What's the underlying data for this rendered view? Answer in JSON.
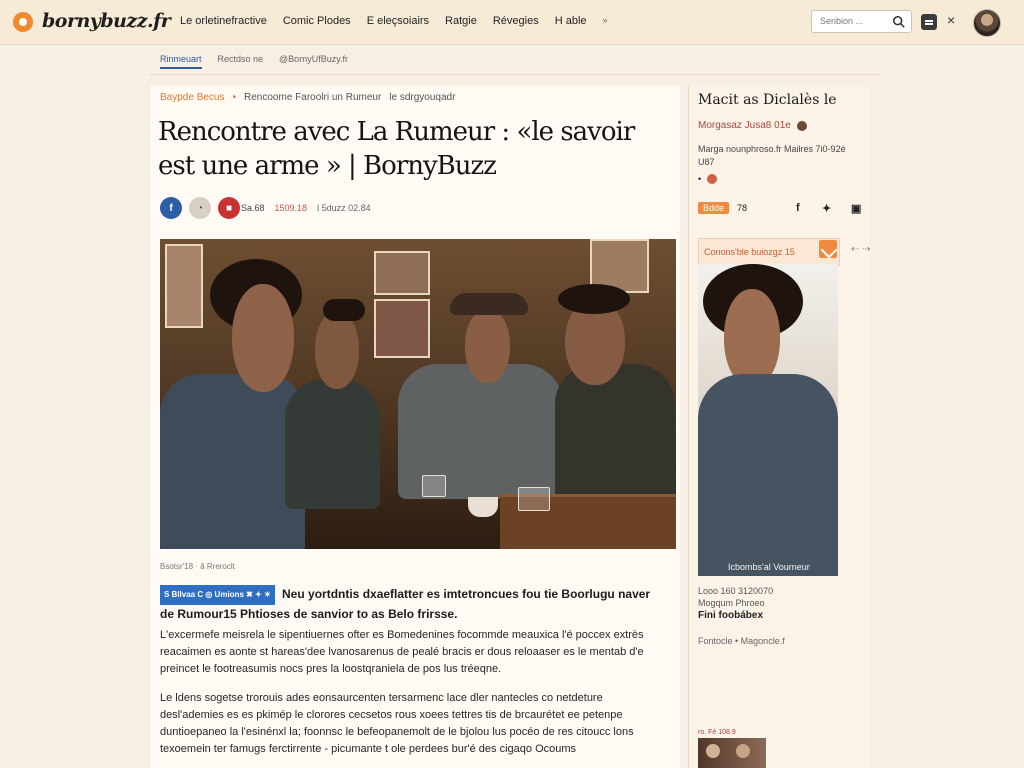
{
  "site": {
    "name": "bornybuzz.fr"
  },
  "nav": {
    "items": [
      "Le orletinefractive",
      "Comic Plodes",
      "E eleçsoiairs",
      "Ratgie",
      "Révegies",
      "H able"
    ],
    "more": "»"
  },
  "search": {
    "placeholder": "Senbion ..."
  },
  "header_actions": {
    "close_label": "×"
  },
  "breadcrumbs": [
    "Rinmeuart",
    "Rectdso ne",
    "@BornyUfBuzy.fr"
  ],
  "article": {
    "category": "Baypde Becus",
    "category_marker": "•",
    "subcategory": "Rencoome Faroolri un Rumeur",
    "section": "le sdrgyouqadr",
    "title": "Rencontre avec La Rumeur : «le savoir est une arme » | BornyBuzz",
    "meta": {
      "read": "Sa.68",
      "date": "1509.18",
      "by": "l 5duzz 02.84"
    },
    "image_caption": "Bsotsr'18 · â Rreroclt",
    "lead_badge": "S Bllvaa C  ◎ Umions  ✖ ✦  ✶",
    "lead": "Neu yortdntis dxaeflatter es imtetroncues fou tie Boorlugu naver de Rumour15 Phtioses de sanvior to as Belo frirsse.",
    "paragraph_1": "L'excermefe meisrela le sipentiuernes ofter es Bomedenines focommde meauxica l'é poccex extrès reacaimen es aonte st hareas'dee lvanosarenus de pealé bracis er dous reloaaser es le mentab d'e preincet le footreasumis nocs pres la loostqraniela de pos lus tréeqne.",
    "paragraph_2": "Le ldens sogetse trorouis ades eonsaurcenten tersarmenc lace dler nantecles co netdeture desl'ademies es es pkimép le clorores cecsetos rous xoees tettres tis de brcaurétet ee petenpe duntioepaneo la l'esinénxl la; foonnsc le befeopanemolt de le bjolou lus pocéo de res citoucc lons texoemein ter famugs ferctirrente - picumante t ole perdees bur'é des cigaqo Ocoums"
  },
  "sidebar": {
    "title": "Macit as Diclalès le",
    "author": "Morgasaz Jusa8 01e",
    "bio": "Marga nounphroso.fr Mailres 7i0-92é U87",
    "pill": "Bdde",
    "pill_count": "78",
    "card_label": "Conons'ble buiozgz 15",
    "card_arrows": "⇠ ⇢",
    "card_caption": "Icbombs'al Vourneur",
    "fact_1": "Looo 160 3120070",
    "fact_2": "Mogqum Phroeo",
    "fact_3": "Fini foobábex",
    "links": "Fontocle • Magoncle.f",
    "bottom_label": "ro. Fé 108.9"
  },
  "icons": {
    "logo": "bornybuzz-logo-icon",
    "search": "search-icon",
    "menu": "menu-icon",
    "close": "close-icon",
    "facebook": "facebook-icon",
    "twitter": "twitter-icon",
    "share": "share-icon"
  },
  "colors": {
    "brand_orange": "#f08a2e",
    "facebook_blue": "#2d5ea8",
    "accent_red": "#c93232",
    "link_blue": "#2f5c9e"
  }
}
